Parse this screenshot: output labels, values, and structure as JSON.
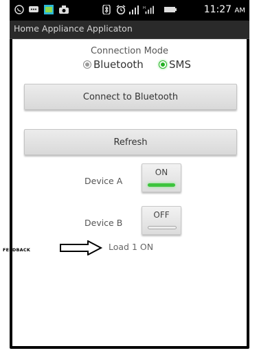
{
  "status_bar": {
    "time": "11:27",
    "ampm": "AM",
    "icons": [
      "whatsapp-icon",
      "chat-icon",
      "image-icon",
      "camera-icon",
      "bluetooth-icon",
      "alarm-icon",
      "signal-icon",
      "signal-icon-2",
      "battery-icon"
    ]
  },
  "app": {
    "title": "Home Appliance Applicaton"
  },
  "connection": {
    "label": "Connection Mode",
    "options": [
      {
        "label": "Bluetooth",
        "selected": false
      },
      {
        "label": "SMS",
        "selected": true
      }
    ]
  },
  "buttons": {
    "connect": "Connect to Bluetooth",
    "refresh": "Refresh"
  },
  "devices": [
    {
      "label": "Device A",
      "state": "ON",
      "on": true
    },
    {
      "label": "Device B",
      "state": "OFF",
      "on": false
    }
  ],
  "feedback": {
    "annotation": "FEEDBACK",
    "text": "Load 1 ON"
  },
  "colors": {
    "accent_green": "#3dc43d",
    "status_bar_bg": "#000000",
    "title_bar_bg": "#2a2a2a"
  }
}
